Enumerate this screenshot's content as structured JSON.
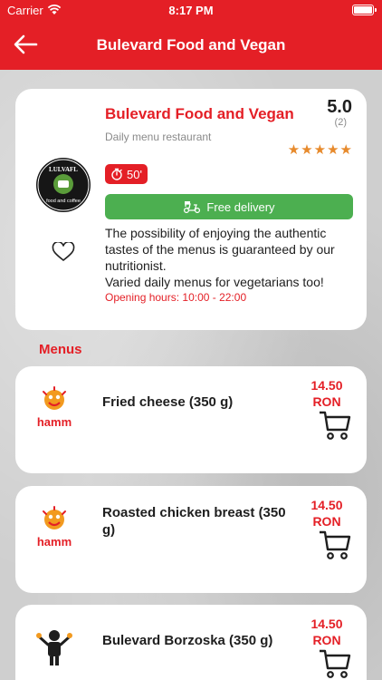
{
  "status_bar": {
    "carrier": "Carrier",
    "time": "8:17 PM"
  },
  "header": {
    "title": "Bulevard Food and Vegan",
    "back_icon": "arrow-left-icon"
  },
  "restaurant": {
    "logo_text_top": "LULVAFL",
    "logo_text_bottom": "food and coffee",
    "name": "Bulevard Food and Vegan",
    "subtitle": "Daily menu restaurant",
    "rating": "5.0",
    "rating_count": "(2)",
    "stars": "★★★★★",
    "prep_time": "50'",
    "delivery_label": "Free delivery",
    "description": "The possibility of enjoying the authentic tastes of the menus is guaranteed by our nutritionist.\nVaried daily menus for vegetarians too!",
    "hours": "Opening hours: 10:00 - 22:00",
    "accent_color": "#e41f26",
    "delivery_color": "#4caf50"
  },
  "menus": {
    "title": "Menus",
    "items": [
      {
        "name": "Fried cheese (350 g)",
        "price": "14.50",
        "currency": "RON",
        "logo_text": "hamm"
      },
      {
        "name": "Roasted chicken breast (350 g)",
        "price": "14.50",
        "currency": "RON",
        "logo_text": "hamm"
      },
      {
        "name": "Bulevard Borzoska (350 g)",
        "price": "14.50",
        "currency": "RON",
        "logo_text": ""
      }
    ]
  }
}
